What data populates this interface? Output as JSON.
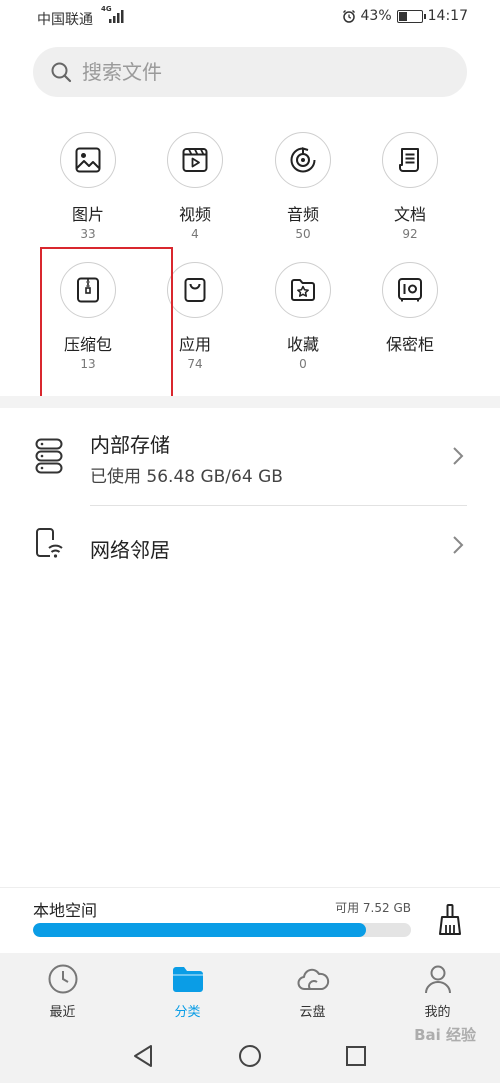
{
  "status_bar": {
    "carrier": "中国联通",
    "network": "4G",
    "battery_percent": "43%",
    "battery_level": 0.43,
    "time": "14:17"
  },
  "search": {
    "placeholder": "搜索文件"
  },
  "categories": [
    {
      "label": "图片",
      "count": "33",
      "icon": "image-icon"
    },
    {
      "label": "视频",
      "count": "4",
      "icon": "video-icon"
    },
    {
      "label": "音频",
      "count": "50",
      "icon": "audio-icon"
    },
    {
      "label": "文档",
      "count": "92",
      "icon": "document-icon"
    },
    {
      "label": "压缩包",
      "count": "13",
      "icon": "archive-icon"
    },
    {
      "label": "应用",
      "count": "74",
      "icon": "app-bag-icon"
    },
    {
      "label": "收藏",
      "count": "0",
      "icon": "star-folder-icon"
    },
    {
      "label": "保密柜",
      "count": "",
      "icon": "safe-icon"
    }
  ],
  "storage": {
    "internal_title": "内部存储",
    "internal_usage": "已使用 56.48 GB/64 GB",
    "network_title": "网络邻居"
  },
  "local_space": {
    "title": "本地空间",
    "available": "可用 7.52 GB",
    "used_fraction": 0.88,
    "accent_color": "#0a9de6"
  },
  "tabs": [
    {
      "label": "最近",
      "icon": "clock-icon",
      "active": false
    },
    {
      "label": "分类",
      "icon": "folder-icon",
      "active": true
    },
    {
      "label": "云盘",
      "icon": "cloud-icon",
      "active": false
    },
    {
      "label": "我的",
      "icon": "user-icon",
      "active": false
    }
  ],
  "watermark": "Bai 经验",
  "highlight_color": "#d9272e"
}
